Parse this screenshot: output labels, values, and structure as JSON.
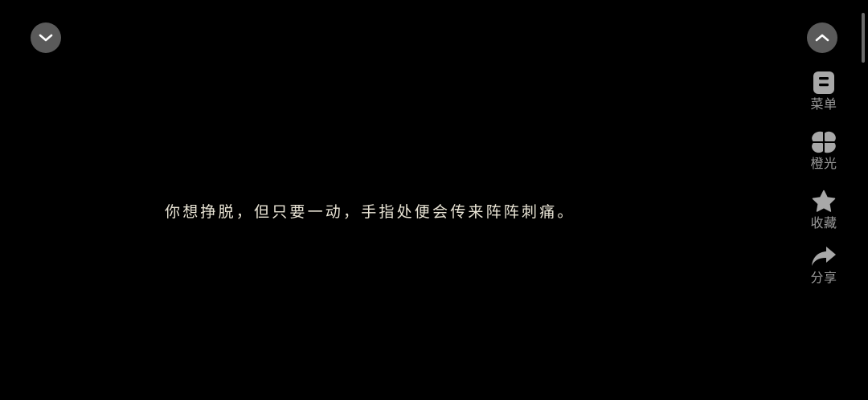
{
  "controls": {
    "collapse_icon": "chevron-down-icon",
    "expand_icon": "chevron-up-icon"
  },
  "side_menu": [
    {
      "key": "menu",
      "label": "菜单",
      "icon": "clipboard-icon"
    },
    {
      "key": "orange-light",
      "label": "橙光",
      "icon": "clover-icon"
    },
    {
      "key": "favorite",
      "label": "收藏",
      "icon": "star-icon"
    },
    {
      "key": "share",
      "label": "分享",
      "icon": "share-arrow-icon"
    }
  ],
  "story": {
    "text": "你想挣脱，但只要一动，手指处便会传来阵阵刺痛。"
  },
  "colors": {
    "background": "#000000",
    "button_bg": "#5a5a5a",
    "icon": "#a8a8a8",
    "menu_label": "#9a9a9a",
    "story_text": "#e8e3d4"
  }
}
